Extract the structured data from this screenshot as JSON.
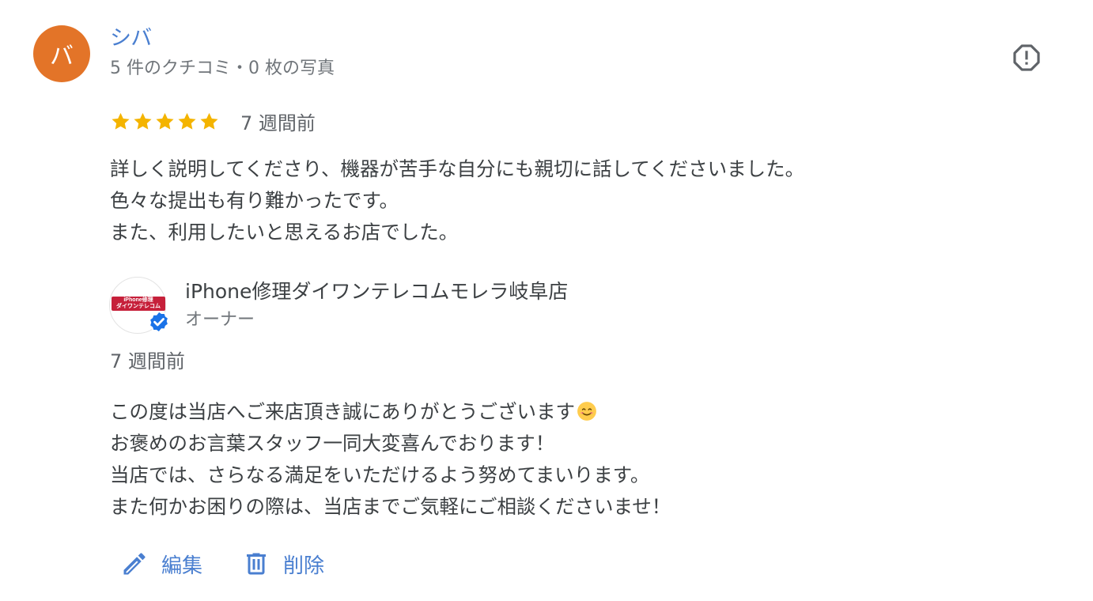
{
  "reviewer": {
    "avatar_initial": "バ",
    "name": "シバ",
    "meta": "5 件のクチコミ・0 枚の写真",
    "avatar_color": "#e37428"
  },
  "review": {
    "rating": 5,
    "max_rating": 5,
    "age": "7 週間前",
    "lines": [
      "詳しく説明してくださり、機器が苦手な自分にも親切に話してくださいました。",
      "色々な提出も有り難かったです。",
      "また、利用したいと思えるお店でした。"
    ]
  },
  "owner": {
    "logo_text_line1": "iPhone修理",
    "logo_text_line2": "ダイワンテレコム",
    "name": "iPhone修理ダイワンテレコムモレラ岐阜店",
    "role": "オーナー",
    "age": "7 週間前",
    "reply_lines": [
      "この度は当店へご来店頂き誠にありがとうございます",
      "お褒めのお言葉スタッフ一同大変喜んでおります！",
      "当店では、さらなる満足をいただけるよう努めてまいります。",
      "また何かお困りの際は、当店までご気軽にご相談くださいませ！"
    ],
    "reply_emoji": "smiling-face-icon"
  },
  "actions": {
    "edit_label": "編集",
    "delete_label": "削除"
  },
  "colors": {
    "accent": "#4a7fd0",
    "star": "#f4b400",
    "badge": "#1a73e8",
    "logo_red": "#c6203a"
  },
  "icons": [
    "report-icon",
    "star-icon",
    "verified-badge-icon",
    "pencil-icon",
    "trash-icon"
  ]
}
